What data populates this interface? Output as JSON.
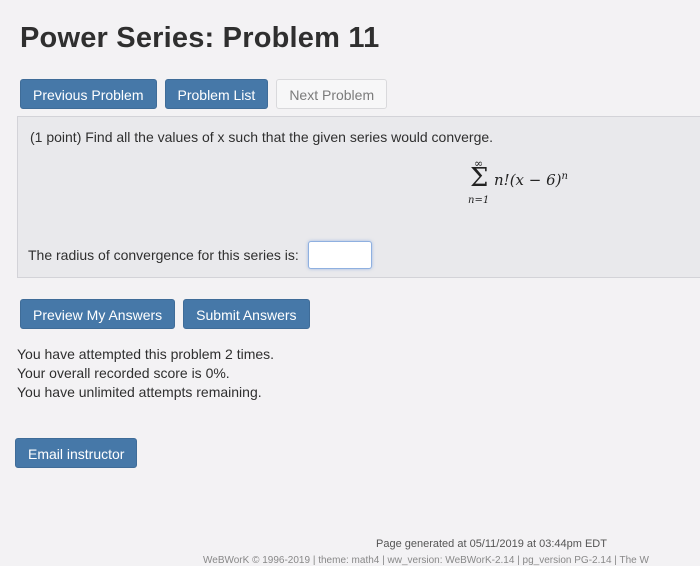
{
  "page": {
    "title": "Power Series: Problem 11"
  },
  "nav": {
    "previous": "Previous Problem",
    "list": "Problem List",
    "next": "Next Problem"
  },
  "problem": {
    "prompt": "(1 point) Find all the values of x such that the given series would converge.",
    "series": {
      "upper_limit": "∞",
      "lower_limit": "n=1",
      "term": "n!(x − 6)",
      "exponent": "n"
    },
    "radius_label": "The radius of convergence for this series is:",
    "answer_value": ""
  },
  "actions": {
    "preview": "Preview My Answers",
    "submit": "Submit Answers"
  },
  "status": {
    "attempts": "You have attempted this problem 2 times.",
    "score": "Your overall recorded score is 0%.",
    "remaining": "You have unlimited attempts remaining."
  },
  "email": {
    "label": "Email instructor"
  },
  "footer": {
    "generated": "Page generated at 05/11/2019 at 03:44pm EDT",
    "version": "WeBWorK © 1996-2019 | theme: math4 | ww_version: WeBWorK-2.14 | pg_version PG-2.14 | The W"
  },
  "colors": {
    "primary": "#4678a8",
    "background": "#f3f2f4",
    "panel": "#e9e9ec"
  }
}
